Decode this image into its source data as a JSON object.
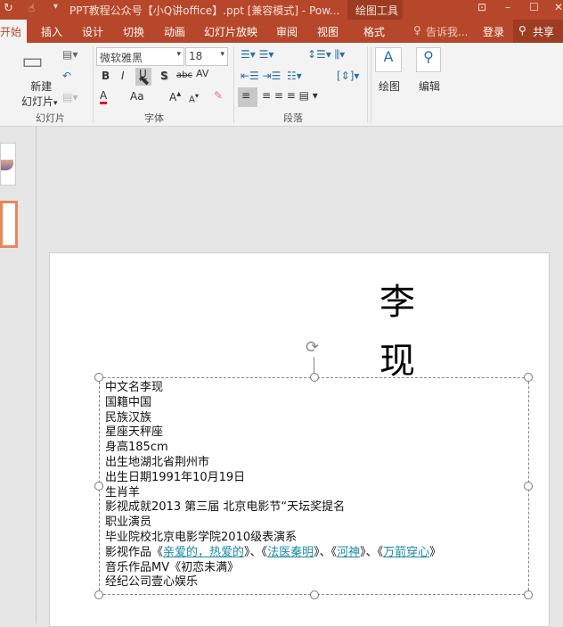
{
  "titlebar": {
    "title": "PPT教程公众号【小Q讲office】.ppt [兼容模式] - Pow...",
    "context_tab": "绘图工具"
  },
  "tabs": [
    "开始",
    "插入",
    "设计",
    "切换",
    "动画",
    "幻灯片放映",
    "审阅",
    "视图",
    "格式"
  ],
  "tell_me": "告诉我...",
  "login": "登录",
  "share": "共享",
  "ribbon": {
    "new_slide": "新建\n幻灯片",
    "new_slide_1": "新建",
    "new_slide_2": "幻灯片",
    "font_name": "微软雅黑",
    "font_size": "18",
    "groups": {
      "slides": "幻灯片",
      "font": "字体",
      "paragraph": "段落"
    },
    "drawing": "绘图",
    "editing": "编辑",
    "bold": "B",
    "italic": "I",
    "underline": "U",
    "shadow": "S",
    "strike": "abc",
    "spacing": "AV",
    "case": "Aa",
    "color_accent": "#e81123"
  },
  "slide": {
    "title": [
      "李",
      "现"
    ],
    "lines": [
      "中文名李现",
      "国籍中国",
      "民族汉族",
      "星座天秤座",
      "身高185cm",
      "出生地湖北省荆州市",
      "出生日期1991年10月19日",
      "生肖羊",
      "影视成就2013 第三届 北京电影节“天坛奖提名",
      "职业演员",
      "毕业院校北京电影学院2010级表演系"
    ],
    "works": {
      "prefix": "影视作品",
      "items": [
        "亲爱的，热爱的",
        "法医秦明",
        "河神",
        "万箭穿心"
      ]
    },
    "music": "音乐作品MV《初恋未满》",
    "company": "经纪公司壹心娱乐"
  }
}
